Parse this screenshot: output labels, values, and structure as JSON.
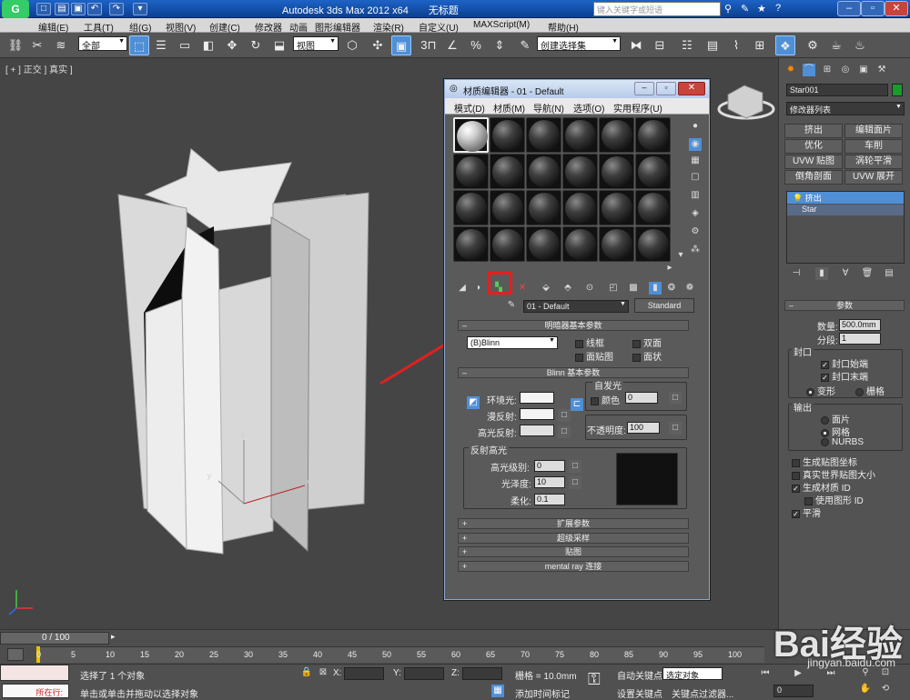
{
  "titlebar": {
    "app_title": "Autodesk 3ds Max  2012 x64",
    "doc_title": "无标题",
    "search_placeholder": "键入关键字或短语"
  },
  "menubar": {
    "items": [
      "编辑(E)",
      "工具(T)",
      "组(G)",
      "视图(V)",
      "创建(C)",
      "修改器",
      "动画",
      "图形编辑器",
      "渲染(R)",
      "自定义(U)",
      "MAXScript(M)",
      "帮助(H)"
    ]
  },
  "toolbar": {
    "filter": "全部",
    "view": "视图",
    "selection_set": "创建选择集",
    "num": "3"
  },
  "viewport": {
    "label": "[ + ] 正交 ] 真实 ]",
    "axis_x": "x",
    "axis_y": "y",
    "axis_z": "z"
  },
  "command_panel": {
    "object_name": "Star001",
    "modifier_list": "修改器列表",
    "mod_buttons": [
      "挤出",
      "编辑面片",
      "优化",
      "车削",
      "UVW 贴图",
      "涡轮平滑",
      "倒角剖面",
      "UVW 展开"
    ],
    "stack": [
      "挤出",
      "Star"
    ],
    "params_title": "参数",
    "amount_label": "数量:",
    "amount_value": "500.0mm",
    "segments_label": "分段:",
    "segments_value": "1",
    "cap_title": "封口",
    "cap_start": "封口始端",
    "cap_end": "封口末端",
    "morph": "变形",
    "grid": "栅格",
    "output_title": "输出",
    "out_patch": "面片",
    "out_mesh": "网格",
    "out_nurbs": "NURBS",
    "gen_map": "生成贴图坐标",
    "real_world": "真实世界贴图大小",
    "gen_matid": "生成材质 ID",
    "use_shape": "使用图形 ID",
    "smooth": "平滑"
  },
  "material_editor": {
    "title": "材质编辑器 - 01 - Default",
    "menus": [
      "模式(D)",
      "材质(M)",
      "导航(N)",
      "选项(O)",
      "实用程序(U)"
    ],
    "material_name": "01 - Default",
    "material_type": "Standard",
    "shader_title": "明暗器基本参数",
    "shader_type": "(B)Blinn",
    "wire": "线框",
    "two_sided": "双面",
    "face_map": "面贴图",
    "faceted": "面状",
    "blinn_title": "Blinn 基本参数",
    "self_illum": "自发光",
    "color": "颜色",
    "self_illum_value": "0",
    "ambient": "环境光:",
    "diffuse": "漫反射:",
    "specular": "高光反射:",
    "opacity": "不透明度:",
    "opacity_value": "100",
    "spec_title": "反射高光",
    "spec_level": "高光级别:",
    "spec_level_value": "0",
    "gloss": "光泽度:",
    "gloss_value": "10",
    "soften": "柔化:",
    "soften_value": "0.1",
    "rollouts": [
      "扩展参数",
      "超级采样",
      "贴图",
      "mental ray 连接"
    ]
  },
  "timeline": {
    "frame": "0 / 100",
    "ticks": [
      "0",
      "5",
      "10",
      "15",
      "20",
      "25",
      "30",
      "35",
      "40",
      "45",
      "50",
      "55",
      "60",
      "65",
      "70",
      "75",
      "80",
      "85",
      "90",
      "95",
      "100"
    ]
  },
  "status": {
    "line1": "选择了 1 个对象",
    "line2": "单击或单击并拖动以选择对象",
    "current": "所在行:",
    "x": "X:",
    "y": "Y:",
    "z": "Z:",
    "grid": "栅格 = 10.0mm",
    "add_time_tag": "添加时间标记",
    "auto_key": "自动关键点",
    "set_key": "设置关键点",
    "selected": "选定对象",
    "key_filter": "关键点过滤器...",
    "frame_value": "0"
  },
  "watermark": {
    "brand": "Bai经验",
    "url": "jingyan.baidu.com"
  },
  "colors": {
    "highlight": "#e32020",
    "accent": "#4f8fd6"
  }
}
